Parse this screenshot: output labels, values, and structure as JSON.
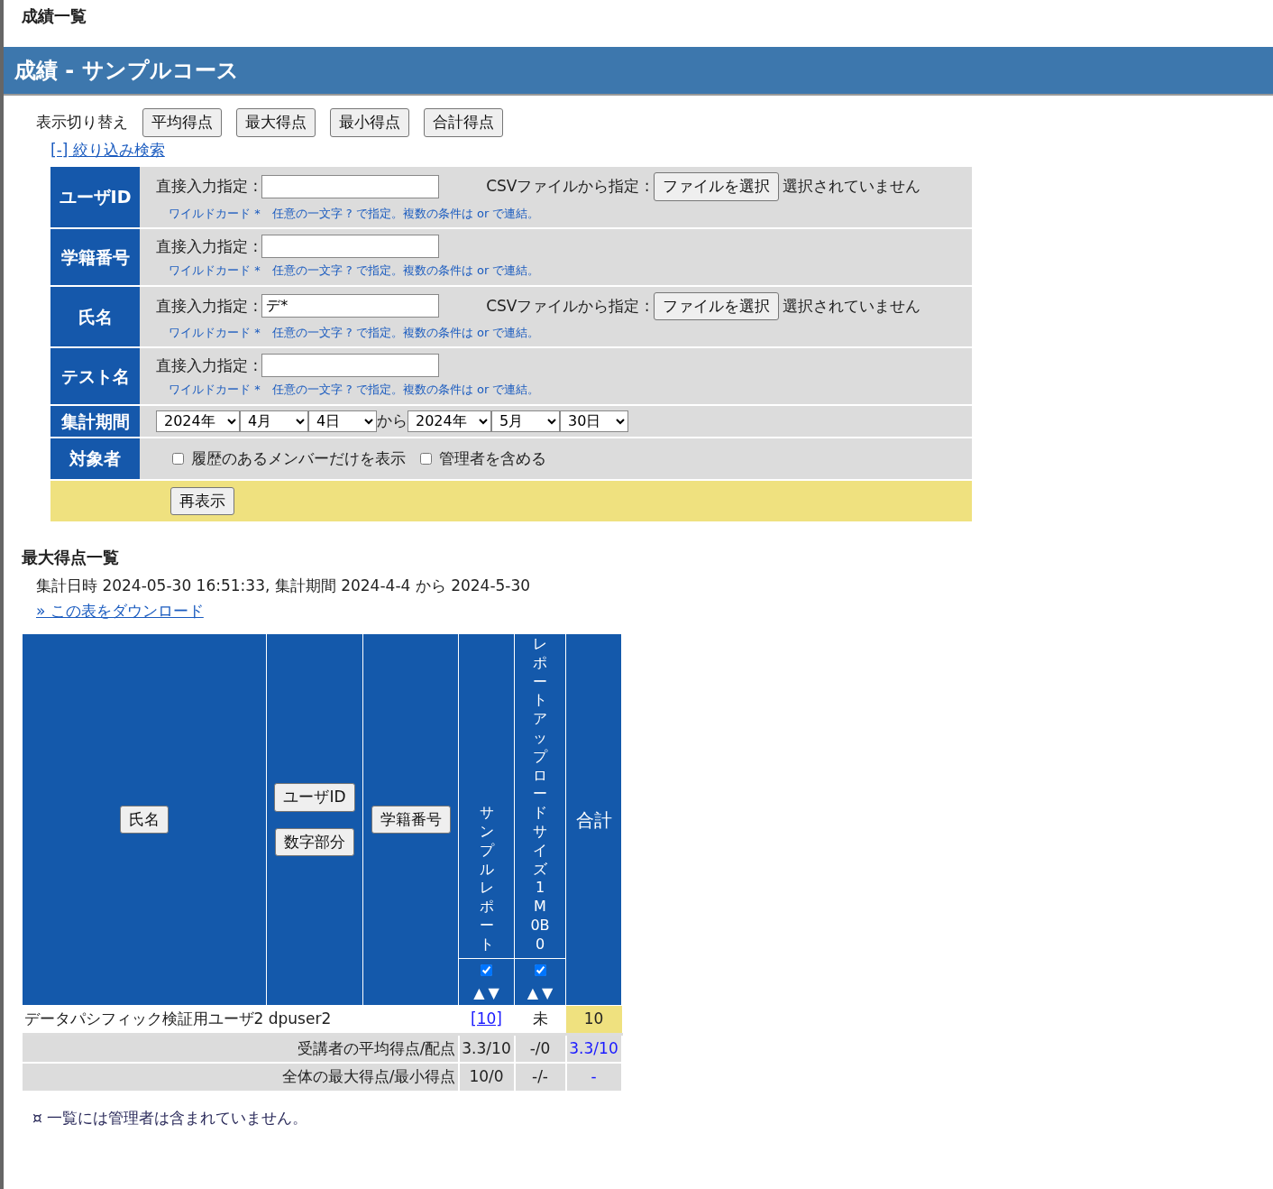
{
  "page_title": "成績一覧",
  "header": "成績 - サンプルコース",
  "view_switch": {
    "label": "表示切り替え",
    "buttons": [
      "平均得点",
      "最大得点",
      "最小得点",
      "合計得点"
    ]
  },
  "filter_toggle": "[-] 絞り込み検索",
  "filters": [
    {
      "kind": "text",
      "label": "ユーザID",
      "field_label": "直接入力指定 :",
      "hint": "ワイルドカード *　任意の一文字 ? で指定。複数の条件は or で連結。",
      "csv": {
        "label": "CSVファイルから指定 :",
        "button": "ファイルを選択",
        "status": "選択されていません"
      }
    },
    {
      "kind": "text",
      "label": "学籍番号",
      "field_label": "直接入力指定 :",
      "hint": "ワイルドカード *　任意の一文字 ? で指定。複数の条件は or で連結。"
    },
    {
      "kind": "text",
      "label": "氏名",
      "field_label": "直接入力指定 :",
      "value": "デ*",
      "hint": "ワイルドカード *　任意の一文字 ? で指定。複数の条件は or で連結。",
      "csv": {
        "label": "CSVファイルから指定 :",
        "button": "ファイルを選択",
        "status": "選択されていません"
      }
    },
    {
      "kind": "text",
      "label": "テスト名",
      "field_label": "直接入力指定 :",
      "hint": "ワイルドカード *　任意の一文字 ? で指定。複数の条件は or で連結。"
    },
    {
      "kind": "period",
      "label": "集計期間",
      "from": [
        "2024年",
        "4月",
        "4日"
      ],
      "separator": "から",
      "to": [
        "2024年",
        "5月",
        "30日"
      ]
    },
    {
      "kind": "checkboxes",
      "label": "対象者",
      "options": [
        {
          "label": "履歴のあるメンバーだけを表示",
          "checked": false
        },
        {
          "label": "管理者を含める",
          "checked": false
        }
      ]
    }
  ],
  "submit": "再表示",
  "section_title": "最大得点一覧",
  "summary": "集計日時 2024-05-30 16:51:33, 集計期間 2024-4-4 から 2024-5-30",
  "download_link": "» この表をダウンロード",
  "table": {
    "name_column": {
      "buttons": [
        "氏名"
      ]
    },
    "id_column": {
      "buttons": [
        "ユーザID",
        "数字部分"
      ]
    },
    "number_column": {
      "buttons": [
        "学籍番号"
      ]
    },
    "tests": [
      {
        "title": "サンプルレポート",
        "checked": true,
        "sort_up": "▲",
        "sort_down": "▼"
      },
      {
        "title": "レポートアップロードサイズ1M0B0",
        "checked": true,
        "sort_up": "▲",
        "sort_down": "▼"
      }
    ],
    "total_column": "合計",
    "rows": [
      {
        "name": "データパシフィック検証用ユーザ2 dpuser2",
        "scores": [
          {
            "text": "[10]",
            "kind": "link"
          },
          {
            "text": "未",
            "kind": "plain"
          }
        ],
        "total": "10"
      }
    ],
    "stats": [
      {
        "label": "受講者の平均得点/配点",
        "values": [
          "3.3/10",
          "-/0"
        ],
        "total": "3.3/10"
      },
      {
        "label": "全体の最大得点/最小得点",
        "values": [
          "10/0",
          "-/-"
        ],
        "total": "-"
      }
    ]
  },
  "note": "¤ 一覧には管理者は含まれていません。"
}
